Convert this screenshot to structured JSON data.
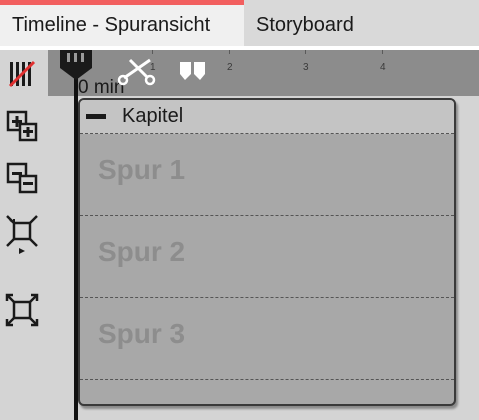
{
  "tabs": [
    {
      "label": "Timeline - Spuransicht",
      "active": true
    },
    {
      "label": "Storyboard",
      "active": false
    }
  ],
  "accent_color": "#f25f5f",
  "ruler": {
    "time_label": "0 min",
    "ticks": [
      "1",
      "2",
      "3",
      "4"
    ]
  },
  "toolbar": {
    "icons": [
      "split-tracks-icon",
      "expand-tracks-icon",
      "collapse-tracks-icon",
      "shrink-view-icon",
      "fit-view-icon"
    ]
  },
  "chapter": {
    "label": "Kapitel",
    "tracks": [
      "Spur 1",
      "Spur 2",
      "Spur 3"
    ]
  }
}
